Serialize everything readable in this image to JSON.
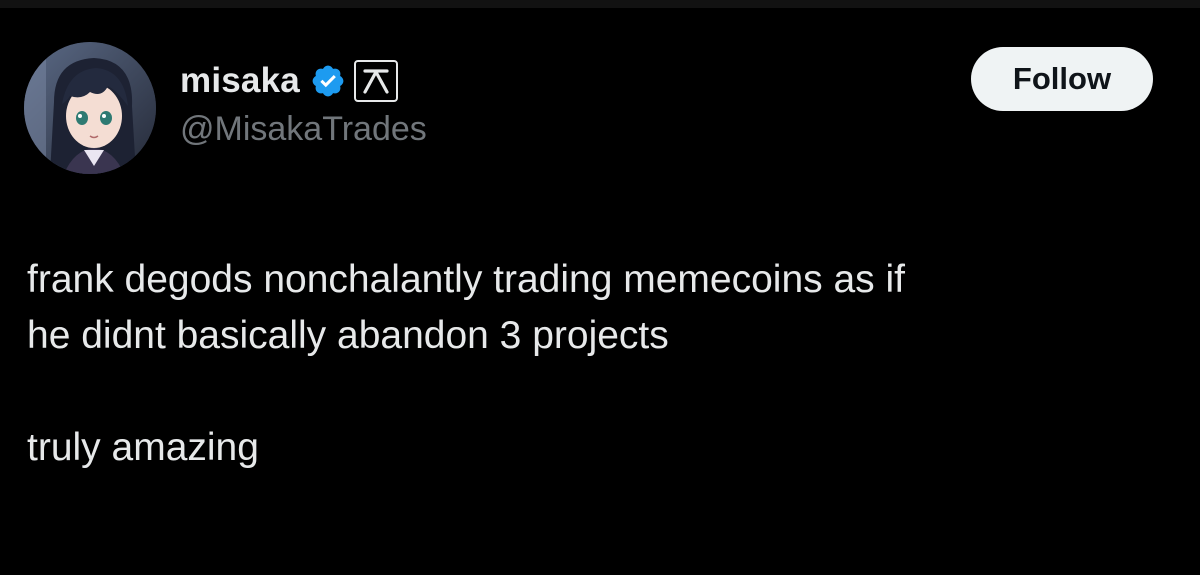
{
  "colors": {
    "background": "#000000",
    "text_primary": "#e7e9ea",
    "text_secondary": "#71767b",
    "verified_blue": "#1d9bf0",
    "follow_button_bg": "#eff3f4",
    "follow_button_text": "#0f1419"
  },
  "author": {
    "display_name": "misaka",
    "handle": "@MisakaTrades",
    "verified_icon": "verified-badge-icon",
    "affiliate_icon": "affiliate-badge-icon",
    "avatar_icon": "anime-avatar"
  },
  "actions": {
    "follow_label": "Follow"
  },
  "tweet": {
    "line1": "frank degods nonchalantly trading memecoins as if",
    "line2": "he didnt basically abandon 3 projects",
    "line3": "truly amazing"
  }
}
